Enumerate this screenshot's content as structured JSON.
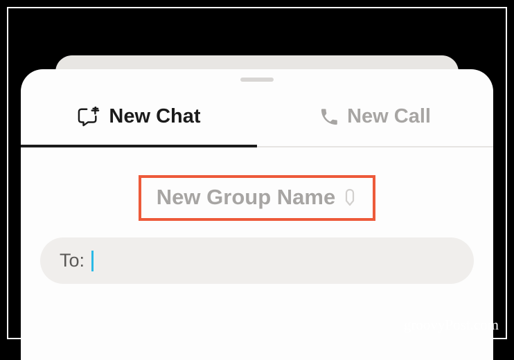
{
  "tabs": {
    "new_chat_label": "New Chat",
    "new_call_label": "New Call"
  },
  "group_name": {
    "placeholder": "New Group Name"
  },
  "to_field": {
    "label": "To:"
  },
  "watermark": "groovyPost.com",
  "colors": {
    "highlight_box": "#ed5a3a",
    "cursor": "#2ab9e6",
    "inactive_text": "#a7a5a3",
    "active_text": "#1b1b1b"
  }
}
